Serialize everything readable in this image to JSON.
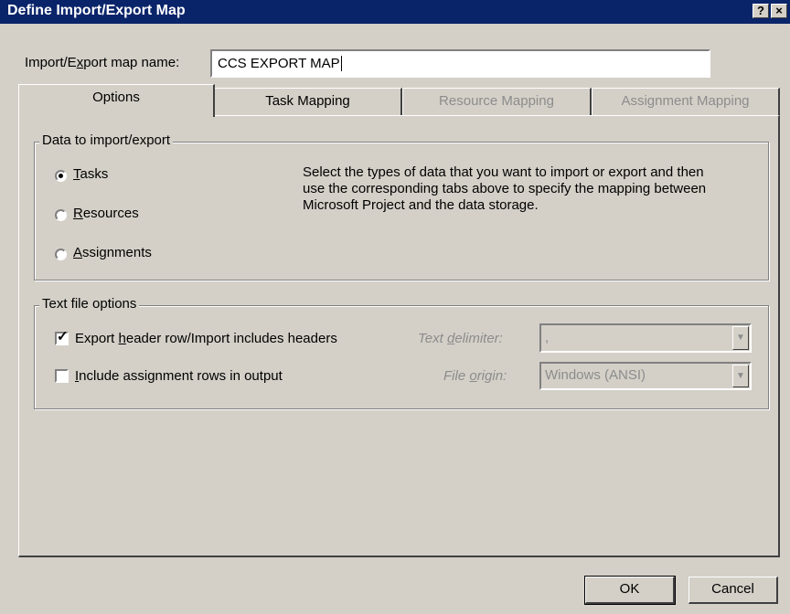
{
  "window": {
    "title": "Define Import/Export Map",
    "help_glyph": "?",
    "close_glyph": "×"
  },
  "map_name": {
    "label_pre": "Import/E",
    "label_key": "x",
    "label_post": "port map name:",
    "value": "CCS EXPORT MAP"
  },
  "tabs": [
    {
      "label": "Options",
      "enabled": true,
      "active": true
    },
    {
      "label": "Task Mapping",
      "enabled": true,
      "active": false
    },
    {
      "label": "Resource Mapping",
      "enabled": false,
      "active": false
    },
    {
      "label": "Assignment Mapping",
      "enabled": false,
      "active": false
    }
  ],
  "data_group": {
    "legend": "Data to import/export",
    "options": [
      {
        "key": "T",
        "rest": "asks",
        "selected": true
      },
      {
        "key": "R",
        "rest": "esources",
        "selected": false
      },
      {
        "key": "A",
        "rest": "ssignments",
        "selected": false
      }
    ],
    "description": "Select the types of data that you want to import or export and then use the corresponding tabs above to specify the mapping between Microsoft Project and the data storage."
  },
  "text_group": {
    "legend": "Text file options",
    "header_checkbox": {
      "pre": "Export ",
      "key": "h",
      "post": "eader row/Import includes headers",
      "checked": true
    },
    "assign_checkbox": {
      "pre": "",
      "key": "I",
      "post": "nclude assignment rows in output",
      "checked": false
    },
    "delimiter": {
      "pre": "Text ",
      "key": "d",
      "post": "elimiter:",
      "value": ","
    },
    "origin": {
      "pre": "File ",
      "key": "o",
      "post": "rigin:",
      "value": "Windows (ANSI)"
    }
  },
  "buttons": {
    "ok": "OK",
    "cancel": "Cancel"
  }
}
